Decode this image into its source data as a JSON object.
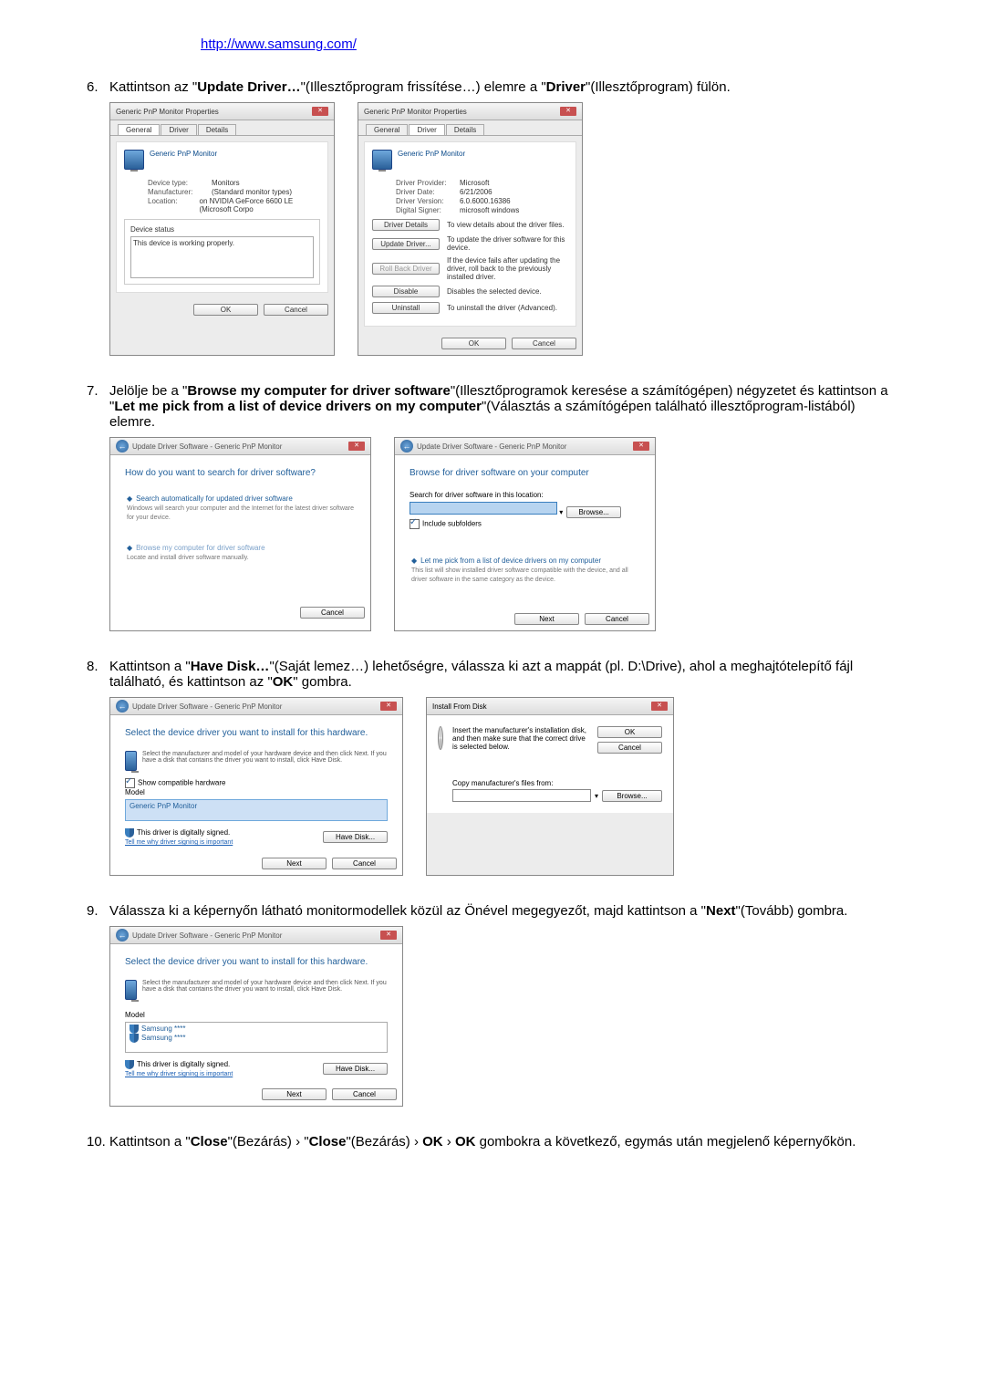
{
  "url": "http://www.samsung.com/",
  "steps": {
    "s6": {
      "num": "6.",
      "text_pre": "Kattintson az \"",
      "b1": "Update Driver…",
      "text_mid1": "\"(Illesztőprogram frissítése…) elemre a \"",
      "b2": "Driver",
      "text_mid2": "\"(Illesztőprogram) fülön."
    },
    "s7": {
      "num": "7.",
      "p1": "Jelölje be a \"",
      "b1": "Browse my computer for driver software",
      "m1": "\"(Illesztőprogramok keresése a számítógépen) négyzetet és kattintson a \"",
      "b2": "Let me pick from a list of device drivers on my computer",
      "m2": "\"(Választás a számítógépen található illesztőprogram-listából) elemre."
    },
    "s8": {
      "num": "8.",
      "p1": "Kattintson a \"",
      "b1": "Have Disk…",
      "m1": "\"(Saját lemez…) lehetőségre, válassza ki azt a mappát (pl. D:\\Drive), ahol a meghajtótelepítő fájl található, és kattintson az \"",
      "b2": "OK",
      "m2": "\" gombra."
    },
    "s9": {
      "num": "9.",
      "p1": "Válassza ki a képernyőn látható monitormodellek közül az Önével megegyezőt, majd kattintson a \"",
      "b1": "Next",
      "m1": "\"(Tovább) gombra."
    },
    "s10": {
      "num": "10.",
      "p1": "Kattintson a \"",
      "b1": "Close",
      "m1": "\"(Bezárás) › \"",
      "b2": "Close",
      "m2": "\"(Bezárás) › ",
      "b3": "OK",
      "m3": " › ",
      "b4": "OK",
      "m4": " gombokra a következő, egymás után megjelenő képernyőkön."
    }
  },
  "dlg_props": {
    "title": "Generic PnP Monitor Properties",
    "tabs": [
      "General",
      "Driver",
      "Details"
    ],
    "monitor_label": "Generic PnP Monitor",
    "device_type_l": "Device type:",
    "device_type_v": "Monitors",
    "manufacturer_l": "Manufacturer:",
    "manufacturer_v": "(Standard monitor types)",
    "location_l": "Location:",
    "location_v": "on NVIDIA GeForce 6600 LE (Microsoft Corpo",
    "status_l": "Device status",
    "status_v": "This device is working properly.",
    "ok": "OK",
    "cancel": "Cancel",
    "drv_provider_l": "Driver Provider:",
    "drv_provider_v": "Microsoft",
    "drv_date_l": "Driver Date:",
    "drv_date_v": "6/21/2006",
    "drv_version_l": "Driver Version:",
    "drv_version_v": "6.0.6000.16386",
    "drv_signer_l": "Digital Signer:",
    "drv_signer_v": "microsoft windows",
    "btn_details": "Driver Details",
    "desc_details": "To view details about the driver files.",
    "btn_update": "Update Driver...",
    "desc_update": "To update the driver software for this device.",
    "btn_rollback": "Roll Back Driver",
    "desc_rollback": "If the device fails after updating the driver, roll back to the previously installed driver.",
    "btn_disable": "Disable",
    "desc_disable": "Disables the selected device.",
    "btn_uninstall": "Uninstall",
    "desc_uninstall": "To uninstall the driver (Advanced)."
  },
  "wiz": {
    "crumb": "Update Driver Software - Generic PnP Monitor",
    "q": "How do you want to search for driver software?",
    "opt1_t": "Search automatically for updated driver software",
    "opt1_d": "Windows will search your computer and the Internet for the latest driver software for your device.",
    "opt2_t": "Browse my computer for driver software",
    "opt2_d": "Locate and install driver software manually.",
    "cancel": "Cancel",
    "browse_h": "Browse for driver software on your computer",
    "loc_l": "Search for driver software in this location:",
    "browse_btn": "Browse...",
    "include": "Include subfolders",
    "opt3_t": "Let me pick from a list of device drivers on my computer",
    "opt3_d": "This list will show installed driver software compatible with the device, and all driver software in the same category as the device.",
    "next": "Next",
    "select_h": "Select the device driver you want to install for this hardware.",
    "select_sub": "Select the manufacturer and model of your hardware device and then click Next. If you have a disk that contains the driver you want to install, click Have Disk.",
    "compat": "Show compatible hardware",
    "model_l": "Model",
    "model_v": "Generic PnP Monitor",
    "signed_l": "This driver is digitally signed.",
    "tell": "Tell me why driver signing is important",
    "have_disk": "Have Disk...",
    "samsung1": "Samsung ****",
    "samsung2": "Samsung ****"
  },
  "install": {
    "title": "Install From Disk",
    "msg": "Insert the manufacturer's installation disk, and then make sure that the correct drive is selected below.",
    "ok": "OK",
    "cancel": "Cancel",
    "copy_l": "Copy manufacturer's files from:",
    "browse": "Browse..."
  }
}
